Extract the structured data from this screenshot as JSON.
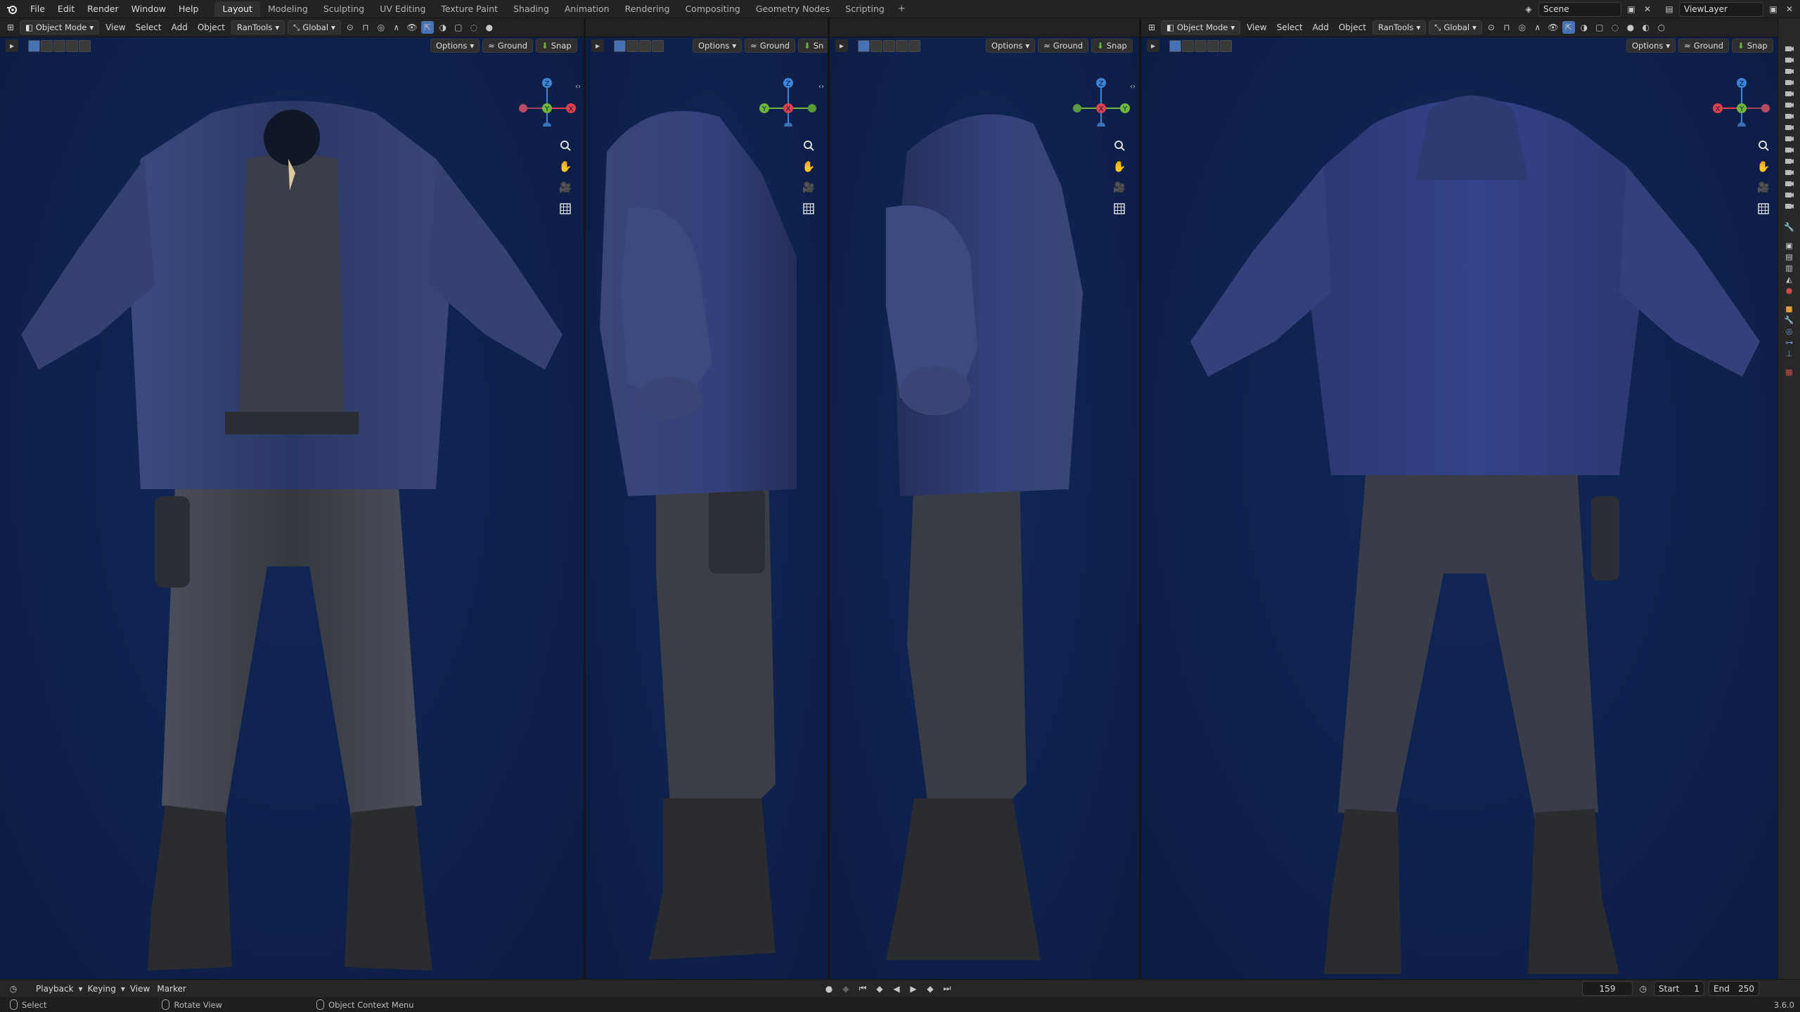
{
  "topbar": {
    "menus": [
      "File",
      "Edit",
      "Render",
      "Window",
      "Help"
    ],
    "workspaces": [
      "Layout",
      "Modeling",
      "Sculpting",
      "UV Editing",
      "Texture Paint",
      "Shading",
      "Animation",
      "Rendering",
      "Compositing",
      "Geometry Nodes",
      "Scripting"
    ],
    "active_workspace": "Layout",
    "scene": "Scene",
    "view_layer": "ViewLayer"
  },
  "viewport_header": {
    "mode": "Object Mode",
    "menus": [
      "View",
      "Select",
      "Add",
      "Object",
      "RanTools"
    ],
    "transform_orientation": "Global"
  },
  "viewport_sub": {
    "options": "Options",
    "ground": "Ground",
    "snap": "Snap",
    "snap_short": "Sn"
  },
  "viewports": [
    {
      "view": "front",
      "gizmo_axes": [
        "Z",
        "Y",
        "X"
      ]
    },
    {
      "view": "right",
      "gizmo_axes": [
        "Z",
        "Y",
        "X"
      ]
    },
    {
      "view": "left",
      "gizmo_axes": [
        "Z",
        "X",
        "Y"
      ]
    },
    {
      "view": "back",
      "gizmo_axes": [
        "Z",
        "X",
        "Y"
      ]
    }
  ],
  "timeline": {
    "menus": [
      "Playback",
      "Keying",
      "View",
      "Marker"
    ],
    "current_frame": "159",
    "start_label": "Start",
    "start": "1",
    "end_label": "End",
    "end": "250"
  },
  "statusbar": {
    "items": [
      "Select",
      "Rotate View",
      "Object Context Menu"
    ],
    "version": "3.6.0"
  },
  "colors": {
    "viewport_bg": "#0f2350",
    "jacket": "#2a3766",
    "pants": "#3a3f4a",
    "boots": "#2a2c30",
    "axis_x": "#e0404e",
    "axis_y": "#6fb63c",
    "axis_z": "#3d85d8"
  }
}
